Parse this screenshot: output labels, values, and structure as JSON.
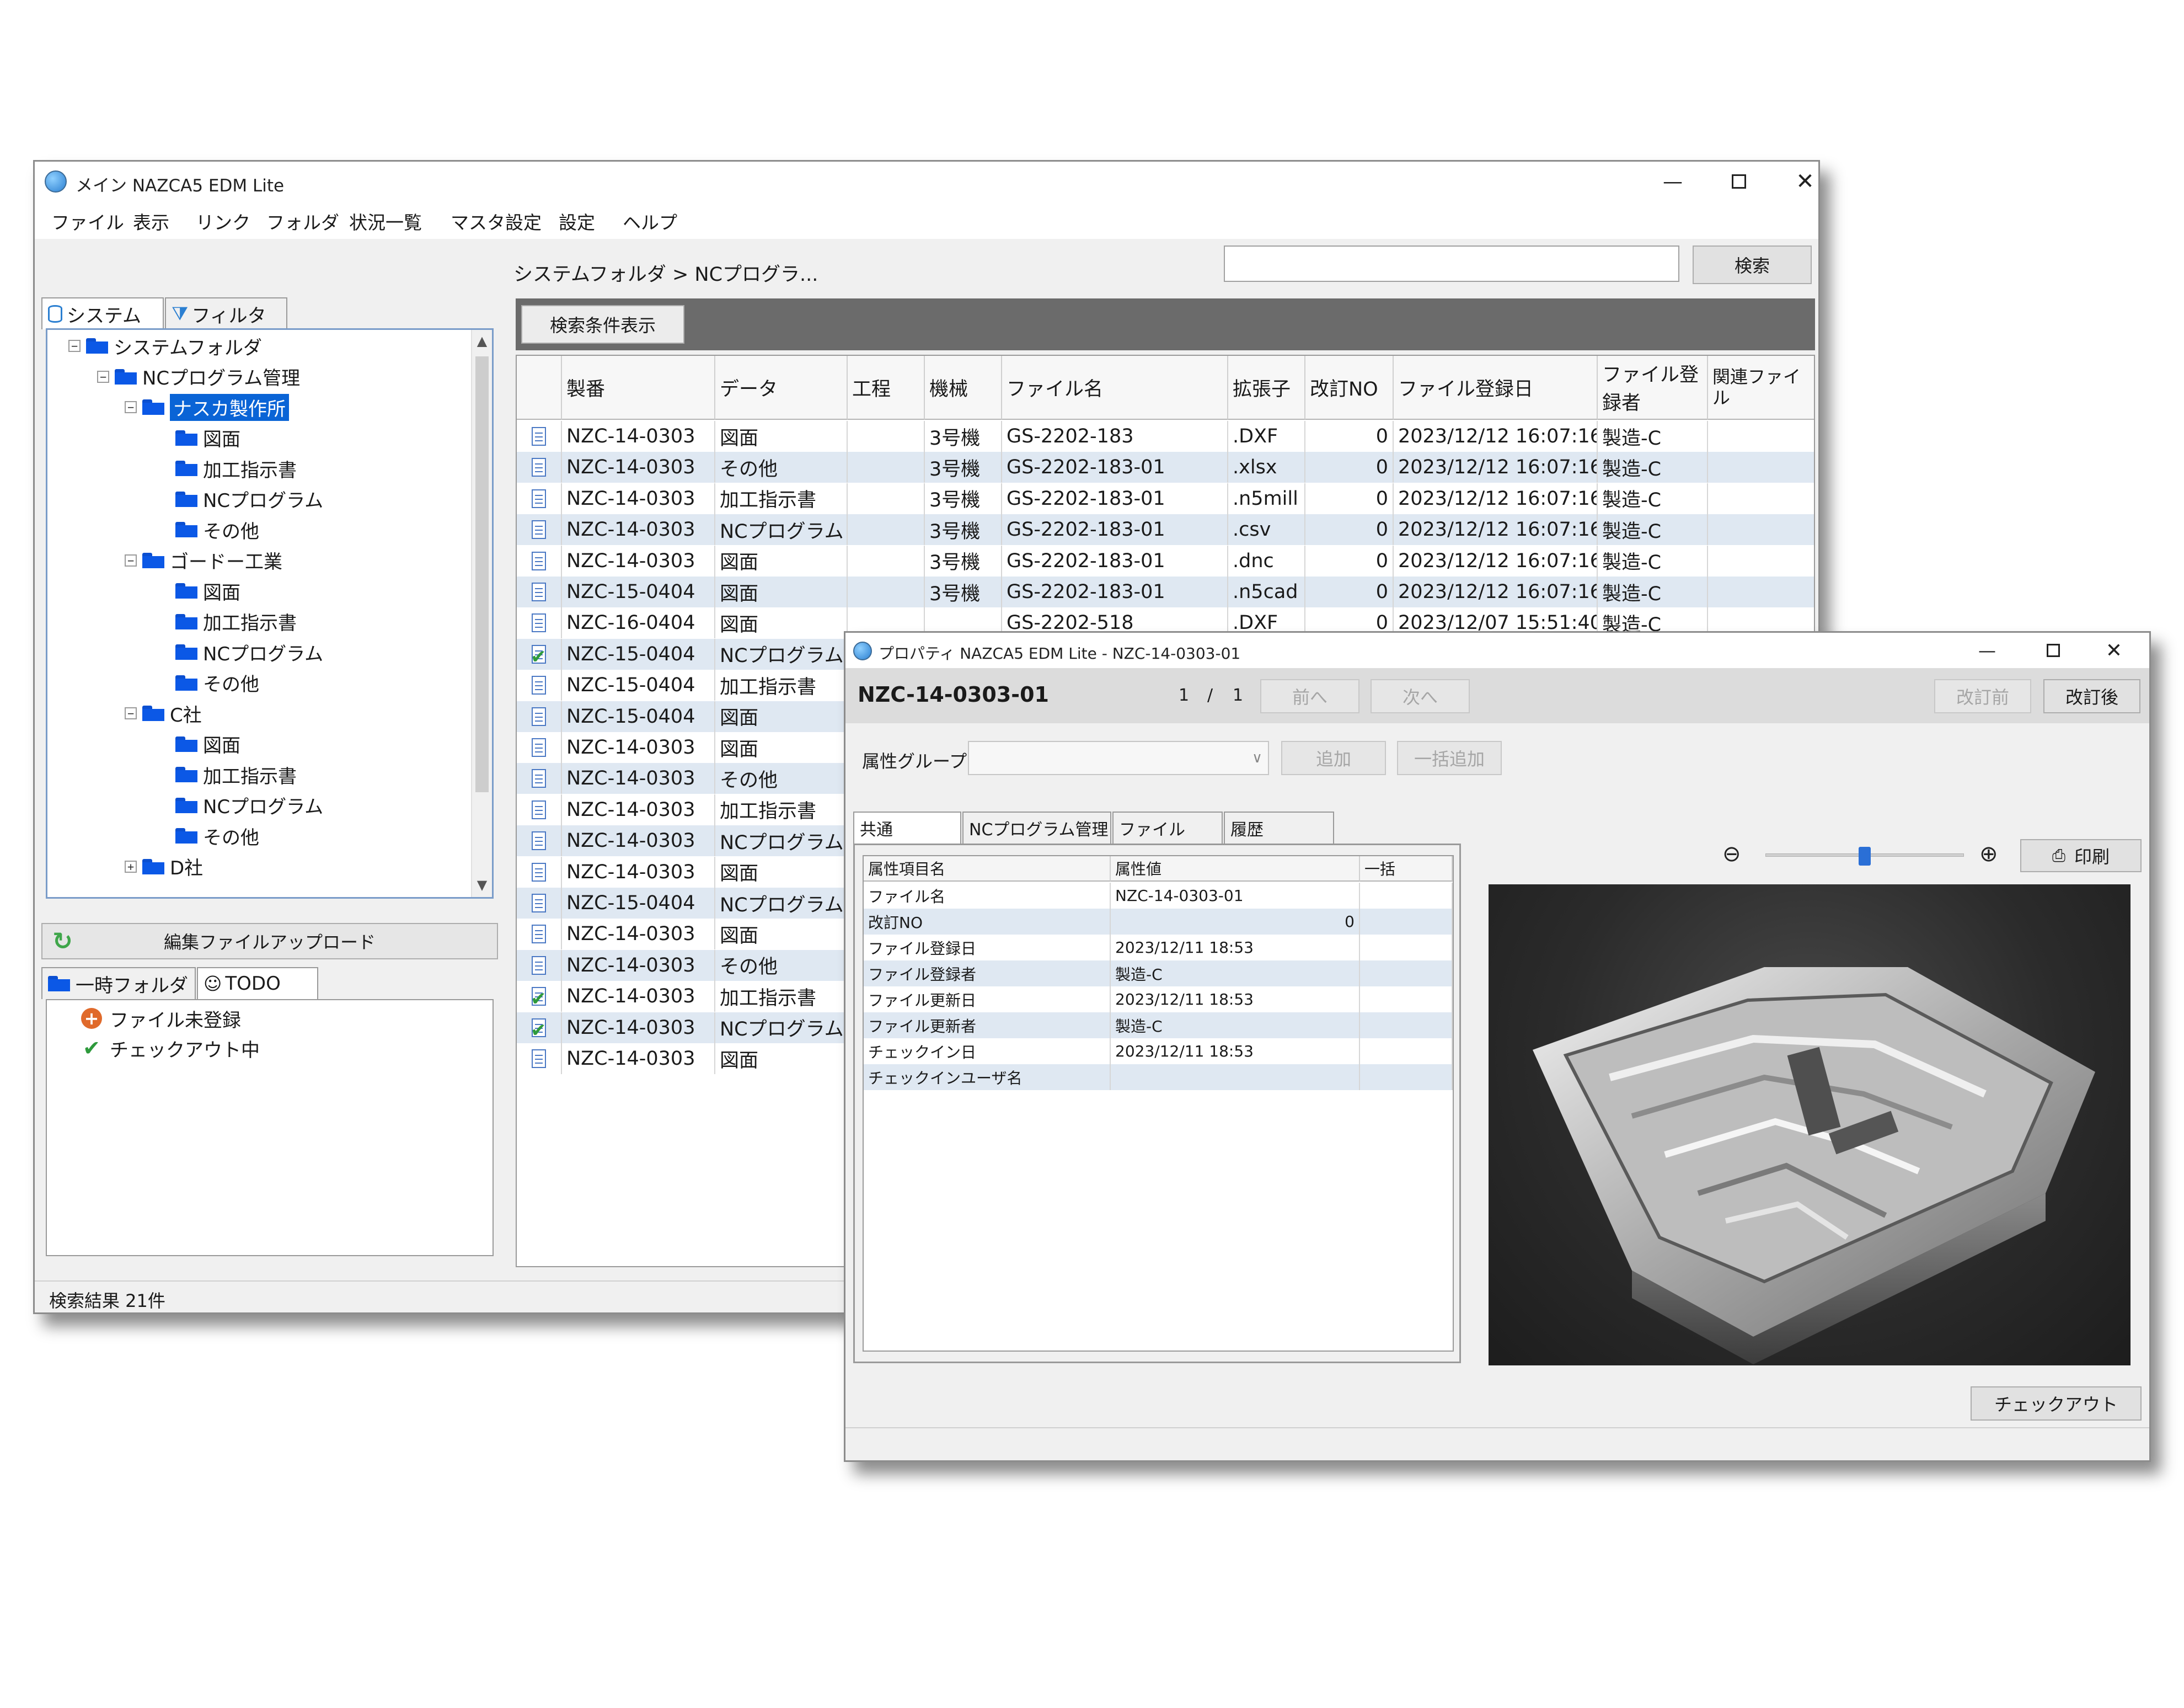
{
  "main_window": {
    "title": "メイン NAZCA5 EDM Lite",
    "menu": [
      "ファイル",
      "表示",
      "リンク",
      "フォルダ",
      "状況一覧",
      "マスタ設定",
      "設定",
      "ヘルプ"
    ],
    "breadcrumb": "システムフォルダ > NCプログラ...",
    "search_value": "",
    "search_button": "検索",
    "show_conditions_button": "検索条件表示",
    "left_tabs": [
      "システム",
      "フィルタ"
    ],
    "tree": [
      {
        "label": "システムフォルダ",
        "level": 0,
        "expander": "−"
      },
      {
        "label": "NCプログラム管理",
        "level": 1,
        "expander": "−"
      },
      {
        "label": "ナスカ製作所",
        "level": 2,
        "expander": "−",
        "selected": true
      },
      {
        "label": "図面",
        "level": 3
      },
      {
        "label": "加工指示書",
        "level": 3
      },
      {
        "label": "NCプログラム",
        "level": 3
      },
      {
        "label": "その他",
        "level": 3
      },
      {
        "label": "ゴードー工業",
        "level": 2,
        "expander": "−"
      },
      {
        "label": "図面",
        "level": 3
      },
      {
        "label": "加工指示書",
        "level": 3
      },
      {
        "label": "NCプログラム",
        "level": 3
      },
      {
        "label": "その他",
        "level": 3
      },
      {
        "label": "C社",
        "level": 2,
        "expander": "−"
      },
      {
        "label": "図面",
        "level": 3
      },
      {
        "label": "加工指示書",
        "level": 3
      },
      {
        "label": "NCプログラム",
        "level": 3
      },
      {
        "label": "その他",
        "level": 3
      },
      {
        "label": "D社",
        "level": 2,
        "expander": "+"
      }
    ],
    "upload_button": "編集ファイルアップロード",
    "bottom_tabs": [
      "一時フォルダ",
      "TODO"
    ],
    "todo_items": [
      "ファイル未登録",
      "チェックアウト中"
    ],
    "status_text": "検索結果 21件",
    "grid_headers": [
      "製番",
      "データ",
      "工程",
      "機械",
      "ファイル名",
      "拡張子",
      "改訂NO",
      "ファイル登録日",
      "ファイル登録者",
      "関連ファイル"
    ],
    "grid_rows": [
      {
        "icon": "doc",
        "c": [
          "NZC-14-0303",
          "図面",
          "",
          "3号機",
          "GS-2202-183",
          ".DXF",
          "0",
          "2023/12/12 16:07:16",
          "製造-C",
          ""
        ]
      },
      {
        "icon": "doc",
        "c": [
          "NZC-14-0303",
          "その他",
          "",
          "3号機",
          "GS-2202-183-01",
          ".xlsx",
          "0",
          "2023/12/12 16:07:16",
          "製造-C",
          ""
        ]
      },
      {
        "icon": "doc",
        "c": [
          "NZC-14-0303",
          "加工指示書",
          "",
          "3号機",
          "GS-2202-183-01",
          ".n5mill",
          "0",
          "2023/12/12 16:07:16",
          "製造-C",
          ""
        ]
      },
      {
        "icon": "doc",
        "rel": true,
        "c": [
          "NZC-14-0303",
          "NCプログラム",
          "",
          "3号機",
          "GS-2202-183-01",
          ".csv",
          "0",
          "2023/12/12 16:07:16",
          "製造-C",
          ""
        ]
      },
      {
        "icon": "doc",
        "c": [
          "NZC-14-0303",
          "図面",
          "",
          "3号機",
          "GS-2202-183-01",
          ".dnc",
          "0",
          "2023/12/12 16:07:16",
          "製造-C",
          ""
        ]
      },
      {
        "icon": "doc",
        "c": [
          "NZC-15-0404",
          "図面",
          "",
          "3号機",
          "GS-2202-183-01",
          ".n5cad",
          "0",
          "2023/12/12 16:07:16",
          "製造-C",
          ""
        ]
      },
      {
        "icon": "doc",
        "c": [
          "NZC-16-0404",
          "図面",
          "",
          "",
          "GS-2202-518",
          ".DXF",
          "0",
          "2023/12/07 15:51:40",
          "製造-C",
          ""
        ]
      },
      {
        "icon": "check",
        "c": [
          "NZC-15-0404",
          "NCプログラム"
        ]
      },
      {
        "icon": "doc",
        "c": [
          "NZC-15-0404",
          "加工指示書"
        ]
      },
      {
        "icon": "doc",
        "c": [
          "NZC-15-0404",
          "図面"
        ]
      },
      {
        "icon": "doc",
        "c": [
          "NZC-14-0303",
          "図面"
        ]
      },
      {
        "icon": "doc",
        "c": [
          "NZC-14-0303",
          "その他"
        ]
      },
      {
        "icon": "doc",
        "c": [
          "NZC-14-0303",
          "加工指示書"
        ]
      },
      {
        "icon": "doc",
        "c": [
          "NZC-14-0303",
          "NCプログラム"
        ]
      },
      {
        "icon": "doc",
        "c": [
          "NZC-14-0303",
          "図面"
        ]
      },
      {
        "icon": "doc",
        "c": [
          "NZC-15-0404",
          "NCプログラム"
        ]
      },
      {
        "icon": "doc",
        "c": [
          "NZC-14-0303",
          "図面"
        ]
      },
      {
        "icon": "doc",
        "c": [
          "NZC-14-0303",
          "その他"
        ]
      },
      {
        "icon": "check",
        "c": [
          "NZC-14-0303",
          "加工指示書"
        ]
      },
      {
        "icon": "check",
        "c": [
          "NZC-14-0303",
          "NCプログラム"
        ]
      },
      {
        "icon": "doc",
        "c": [
          "NZC-14-0303",
          "図面"
        ]
      }
    ]
  },
  "property_window": {
    "title": "プロパティ NAZCA5 EDM Lite - NZC-14-0303-01",
    "record_id": "NZC-14-0303-01",
    "page_current": "1",
    "page_sep": "/",
    "page_total": "1",
    "prev_button": "前へ",
    "next_button": "次へ",
    "rev_prev_button": "改訂前",
    "rev_next_button": "改訂後",
    "attr_group_label": "属性グループ",
    "attr_group_value": "",
    "add_button": "追加",
    "bulk_add_button": "一括追加",
    "tabs": [
      "共通",
      "NCプログラム管理",
      "ファイル",
      "履歴"
    ],
    "grid_headers": [
      "属性項目名",
      "属性値",
      "一括"
    ],
    "grid_rows": [
      [
        "ファイル名",
        "NZC-14-0303-01",
        ""
      ],
      [
        "改訂NO",
        "0",
        ""
      ],
      [
        "ファイル登録日",
        "2023/12/11 18:53",
        ""
      ],
      [
        "ファイル登録者",
        "製造-C",
        ""
      ],
      [
        "ファイル更新日",
        "2023/12/11 18:53",
        ""
      ],
      [
        "ファイル更新者",
        "製造-C",
        ""
      ],
      [
        "チェックイン日",
        "2023/12/11 18:53",
        ""
      ],
      [
        "チェックインユーザ名",
        "",
        ""
      ]
    ],
    "zoom_level": 0.5,
    "print_button": "印刷",
    "checkout_button": "チェックアウト"
  },
  "colors": {
    "selection": "#0a64d6",
    "folder": "#0b58e6",
    "alt_row": "#dfe8f2",
    "dark_bar": "#6b6b6b"
  }
}
